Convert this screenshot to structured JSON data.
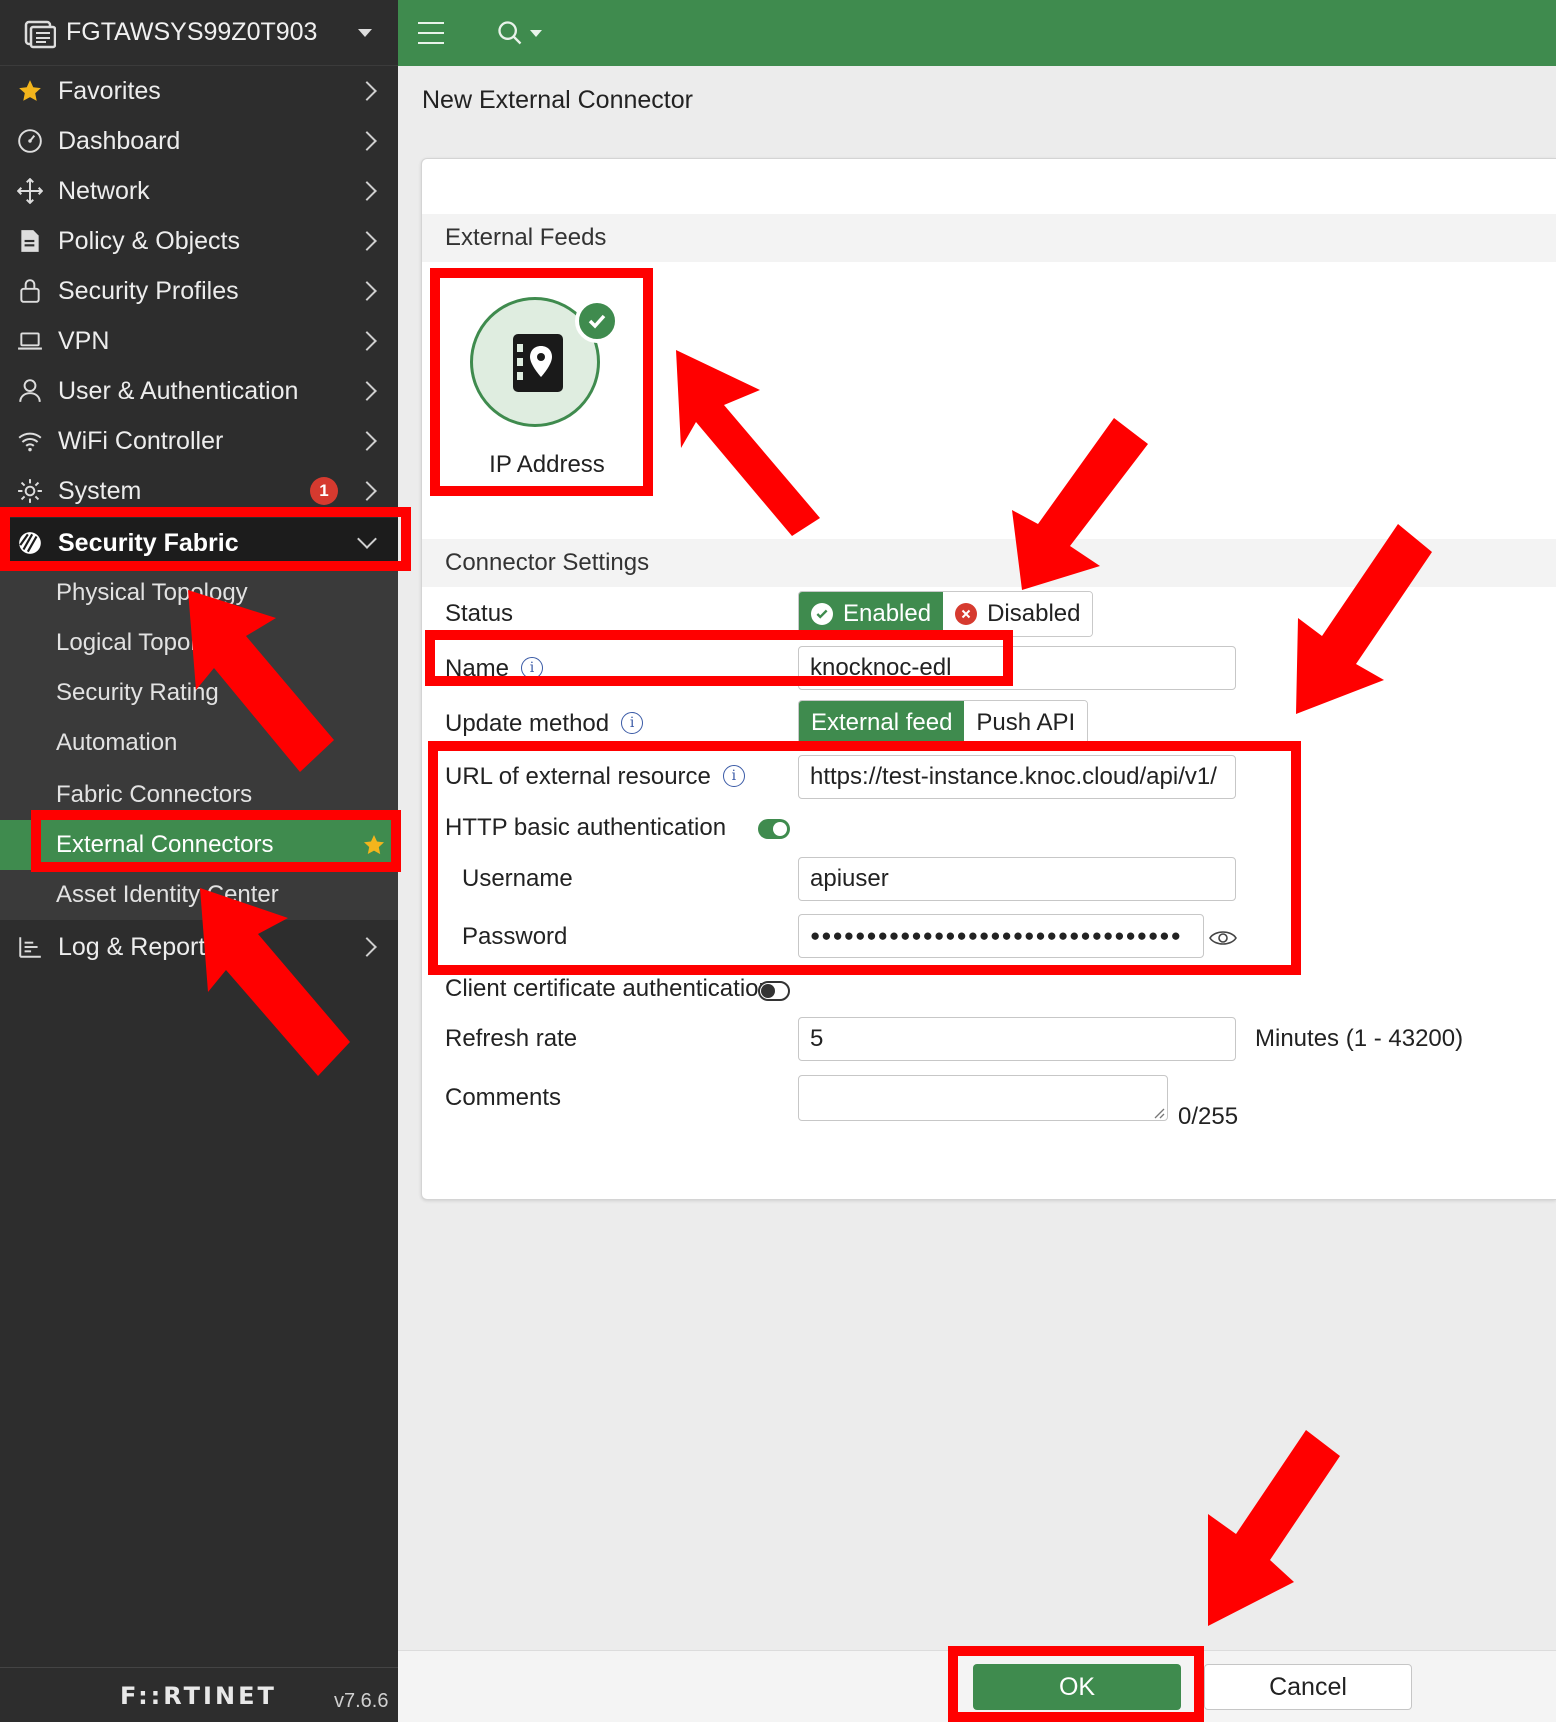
{
  "device": {
    "name": "FGTAWSYS99Z0T903"
  },
  "sidebar": {
    "items": [
      {
        "label": "Favorites",
        "icon": "star-icon"
      },
      {
        "label": "Dashboard",
        "icon": "dashboard-icon"
      },
      {
        "label": "Network",
        "icon": "network-icon"
      },
      {
        "label": "Policy & Objects",
        "icon": "policy-icon"
      },
      {
        "label": "Security Profiles",
        "icon": "lock-icon"
      },
      {
        "label": "VPN",
        "icon": "laptop-icon"
      },
      {
        "label": "User & Authentication",
        "icon": "user-icon"
      },
      {
        "label": "WiFi Controller",
        "icon": "wifi-icon"
      },
      {
        "label": "System",
        "icon": "gear-icon",
        "badge": "1"
      },
      {
        "label": "Security Fabric",
        "icon": "fabric-icon"
      },
      {
        "label": "Log & Report",
        "icon": "log-icon"
      }
    ],
    "sub_items": [
      {
        "label": "Physical Topology"
      },
      {
        "label": "Logical Topology"
      },
      {
        "label": "Security Rating"
      },
      {
        "label": "Automation"
      },
      {
        "label": "Fabric Connectors"
      },
      {
        "label": "External Connectors"
      },
      {
        "label": "Asset Identity Center"
      }
    ],
    "brand": "F::RTINET",
    "version": "v7.6.6"
  },
  "page": {
    "title": "New External Connector"
  },
  "external_feeds": {
    "heading": "External Feeds",
    "card_label": "IP Address"
  },
  "connector_settings": {
    "heading": "Connector Settings",
    "status": {
      "label": "Status",
      "enabled": "Enabled",
      "disabled": "Disabled"
    },
    "name": {
      "label": "Name",
      "value": "knocknoc-edl"
    },
    "update_method": {
      "label": "Update method",
      "external_feed": "External feed",
      "push_api": "Push API"
    },
    "url": {
      "label": "URL of external resource",
      "value": "https://test-instance.knoc.cloud/api/v1/"
    },
    "http_auth": {
      "label": "HTTP basic authentication",
      "enabled": true
    },
    "username": {
      "label": "Username",
      "value": "apiuser"
    },
    "password": {
      "label": "Password",
      "value": "●●●●●●●●●●●●●●●●●●●●●●●●●●●●●●●●●"
    },
    "client_cert": {
      "label": "Client certificate authentication",
      "enabled": false
    },
    "refresh_rate": {
      "label": "Refresh rate",
      "value": "5",
      "hint": "Minutes (1 - 43200)"
    },
    "comments": {
      "label": "Comments",
      "value": "",
      "counter": "0/255"
    }
  },
  "buttons": {
    "ok": "OK",
    "cancel": "Cancel"
  },
  "colors": {
    "accent": "#3f8b4e",
    "sidebar_bg": "#2d2d2d",
    "annotation": "#ff0000"
  }
}
